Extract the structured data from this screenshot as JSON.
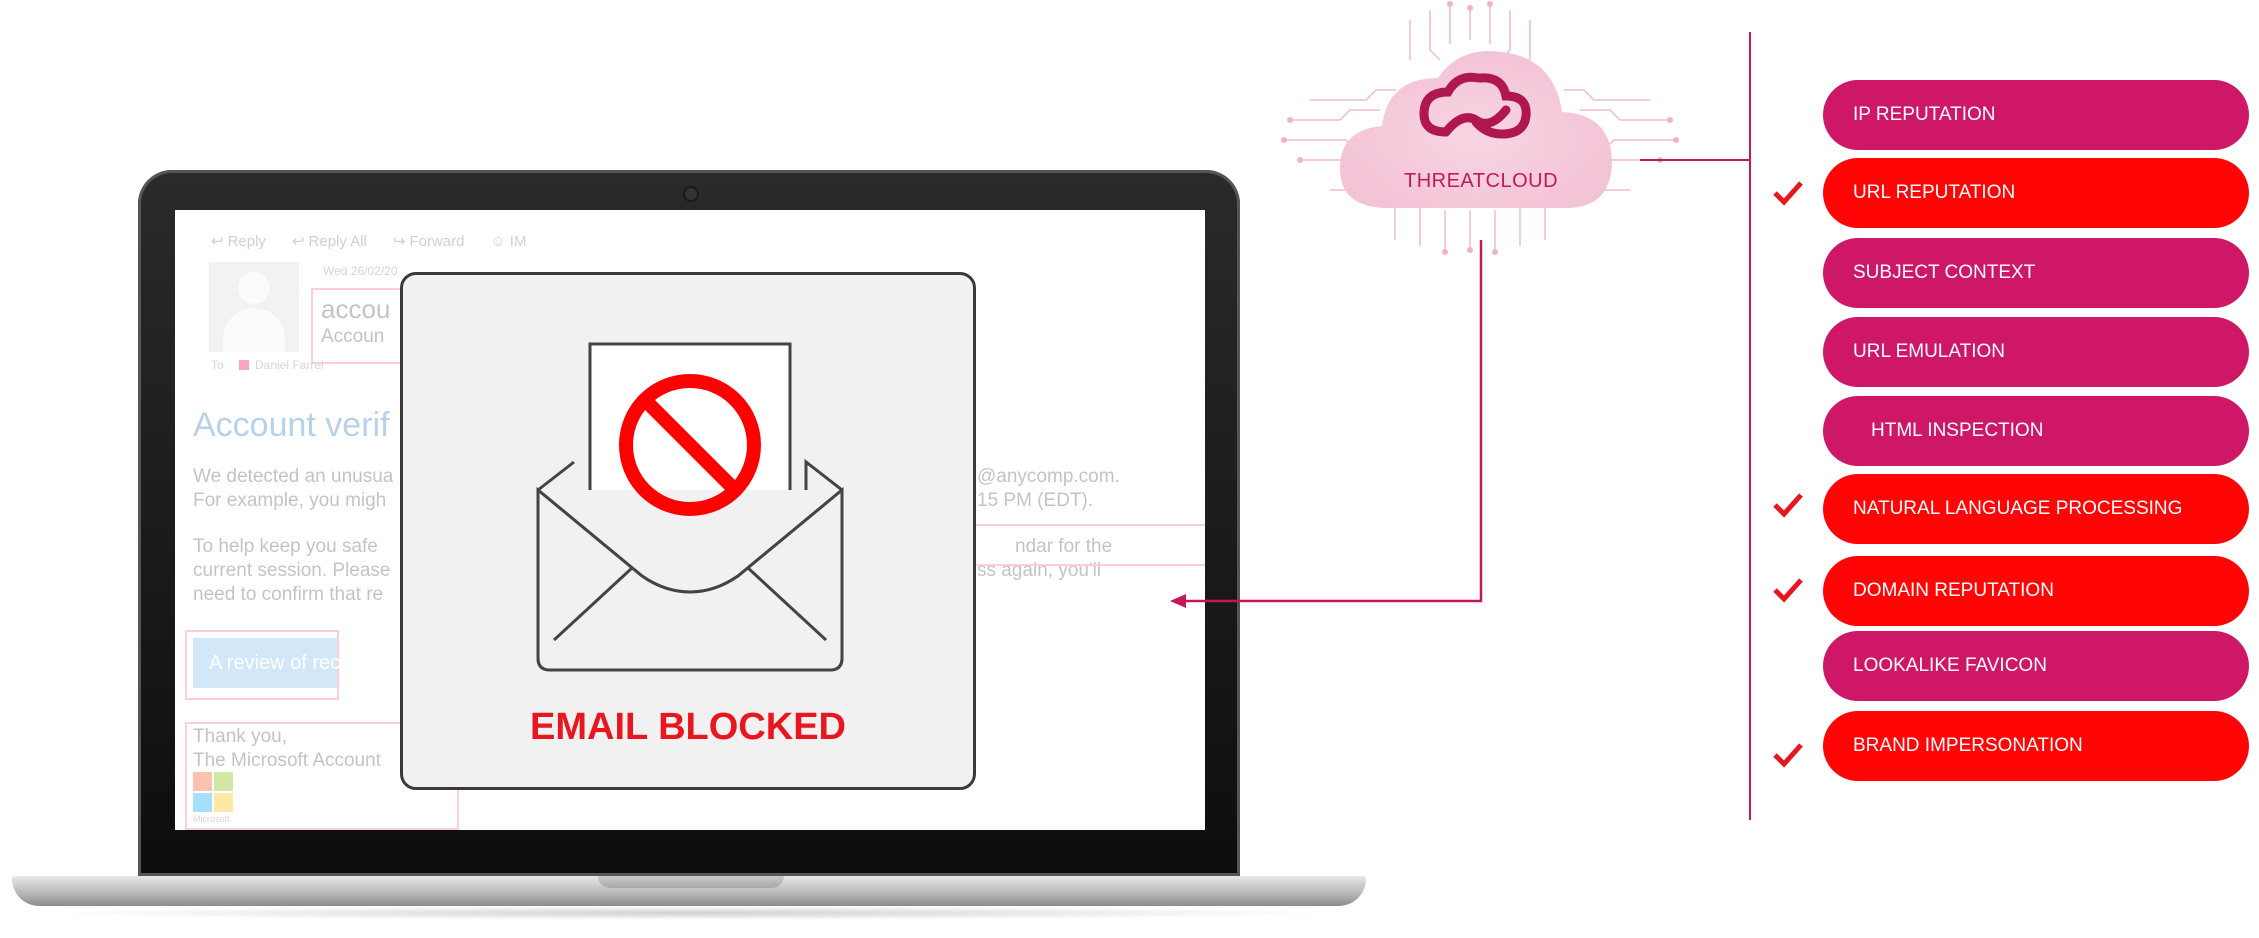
{
  "email": {
    "toolbar": [
      "Reply",
      "Reply All",
      "Forward",
      "IM"
    ],
    "date": "Wed 26/02/20",
    "sender_name": "accou",
    "sender_subject": "Accoun",
    "to_label": "To",
    "to_name": "Daniel Farrel",
    "heading": "Account verif",
    "body_line1_left": "We detected an unusua",
    "body_line1_right": "@anycomp.com.",
    "body_line2_left": "For example, you migh",
    "body_line2_right": "15 PM (EDT).",
    "body_line3_left": "To help keep you safe",
    "body_line3_right": "ndar for the",
    "body_line4_left": "current session. Please",
    "body_line4_right": "ss again, you'll",
    "body_line5_left": "need to confirm that re",
    "button_text": "A review of recent act",
    "signoff": "Thank you,",
    "signature": "The Microsoft Account",
    "logo_label": "Microsoft"
  },
  "blocked": {
    "label": "EMAIL BLOCKED"
  },
  "threatcloud": {
    "label": "THREATCLOUD"
  },
  "checks": [
    {
      "label": "IP REPUTATION",
      "checked": false
    },
    {
      "label": "URL REPUTATION",
      "checked": true
    },
    {
      "label": "SUBJECT CONTEXT",
      "checked": false
    },
    {
      "label": "URL EMULATION",
      "checked": false
    },
    {
      "label": "HTML INSPECTION",
      "checked": false
    },
    {
      "label": "NATURAL LANGUAGE PROCESSING",
      "checked": true
    },
    {
      "label": "DOMAIN REPUTATION",
      "checked": true
    },
    {
      "label": "LOOKALIKE FAVICON",
      "checked": false
    },
    {
      "label": "BRAND IMPERSONATION",
      "checked": true
    }
  ],
  "colors": {
    "magenta": "#cf1768",
    "red": "#ff0505",
    "blocked_red": "#e8171f",
    "line": "#c2185b"
  }
}
